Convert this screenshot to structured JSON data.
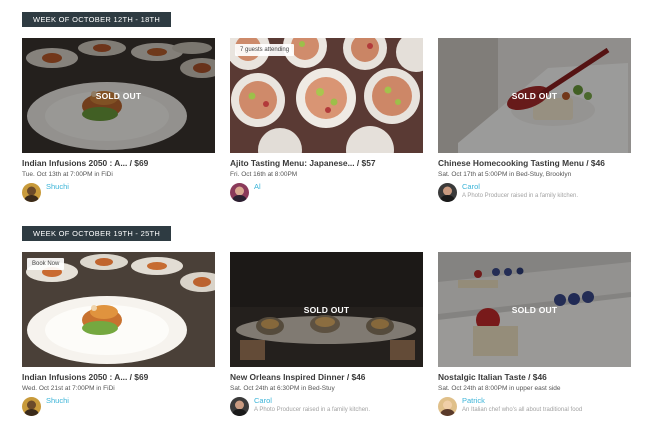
{
  "sections": [
    {
      "week_label": "WEEK OF OCTOBER 12TH - 18TH",
      "cards": [
        {
          "title": "Indian Infusions 2050 : A... / $69",
          "date": "Tue. Oct 13th at 7:00PM in FiDi",
          "host_name": "Shuchi",
          "host_desc": "",
          "status": "SOLD OUT",
          "badge": ""
        },
        {
          "title": "Ajito Tasting Menu: Japanese... / $57",
          "date": "Fri. Oct 16th at 8:00PM",
          "host_name": "Al",
          "host_desc": "",
          "status": "",
          "badge": "7 guests attending"
        },
        {
          "title": "Chinese Homecooking Tasting Menu / $46",
          "date": "Sat. Oct 17th at 5:00PM in Bed-Stuy, Brooklyn",
          "host_name": "Carol",
          "host_desc": "A Photo Producer raised in a family kitchen.",
          "status": "SOLD OUT",
          "badge": ""
        }
      ]
    },
    {
      "week_label": "WEEK OF OCTOBER 19TH - 25TH",
      "cards": [
        {
          "title": "Indian Infusions 2050 : A... / $69",
          "date": "Wed. Oct 21st at 7:00PM in FiDi",
          "host_name": "Shuchi",
          "host_desc": "",
          "status": "",
          "badge": "Book Now"
        },
        {
          "title": "New Orleans Inspired Dinner / $46",
          "date": "Sat. Oct 24th at 6:30PM in Bed-Stuy",
          "host_name": "Carol",
          "host_desc": "A Photo Producer raised in a family kitchen.",
          "status": "SOLD OUT",
          "badge": ""
        },
        {
          "title": "Nostalgic Italian Taste / $46",
          "date": "Sat. Oct 24th at 8:00PM in upper east side",
          "host_name": "Patrick",
          "host_desc": "An Italian chef who's all about traditional food",
          "status": "SOLD OUT",
          "badge": ""
        }
      ]
    }
  ],
  "colors": {
    "week_label_bg": "#2e3b42",
    "host_link": "#3bb4d8",
    "muted_text": "#a3a3a3"
  }
}
